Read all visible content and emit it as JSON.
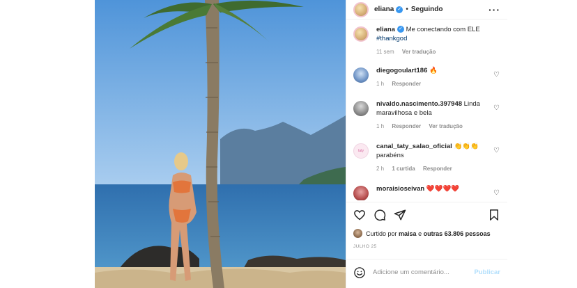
{
  "post": {
    "author": "eliana",
    "separator": "•",
    "follow_status": "Seguindo",
    "caption_text": "Me conectando com ELE",
    "caption_tag": "#thankgod",
    "caption_time": "11 sem",
    "see_translation": "Ver tradução"
  },
  "comments": [
    {
      "user": "diegogoulart186",
      "text": "🔥",
      "time": "1 h",
      "actions": [
        "Responder"
      ],
      "avatar_style": "av-blue"
    },
    {
      "user": "nivaldo.nascimento.397948",
      "text": "Linda maravilhosa e bela",
      "time": "1 h",
      "actions": [
        "Responder",
        "Ver tradução"
      ],
      "avatar_style": "av-gray"
    },
    {
      "user": "canal_taty_salao_oficial",
      "text": "👏👏👏 parabéns",
      "time": "2 h",
      "actions": [
        "1 curtida",
        "Responder"
      ],
      "avatar_style": "av-pink",
      "avatar_text": "taty"
    },
    {
      "user": "moraisioseivan",
      "text": "❤️❤️❤️❤️",
      "time": "",
      "actions": [],
      "avatar_style": "av-red"
    }
  ],
  "likes": {
    "prefix": "Curtido por",
    "user": "maisa",
    "connector": "e",
    "others": "outras 63.806 pessoas"
  },
  "date": "JULHO 25",
  "add_comment": {
    "placeholder": "Adicione um comentário...",
    "publish_label": "Publicar"
  },
  "icons": {
    "more": "more-options-icon",
    "verified": "verified-badge-icon",
    "like": "heart-icon",
    "comment": "comment-icon",
    "share": "paper-plane-icon",
    "save": "bookmark-icon",
    "emoji": "emoji-icon"
  },
  "colors": {
    "verified": "#3897f0",
    "publish_disabled": "#b2dffc",
    "muted_text": "#8e8e8e",
    "hashtag": "#00376b"
  }
}
